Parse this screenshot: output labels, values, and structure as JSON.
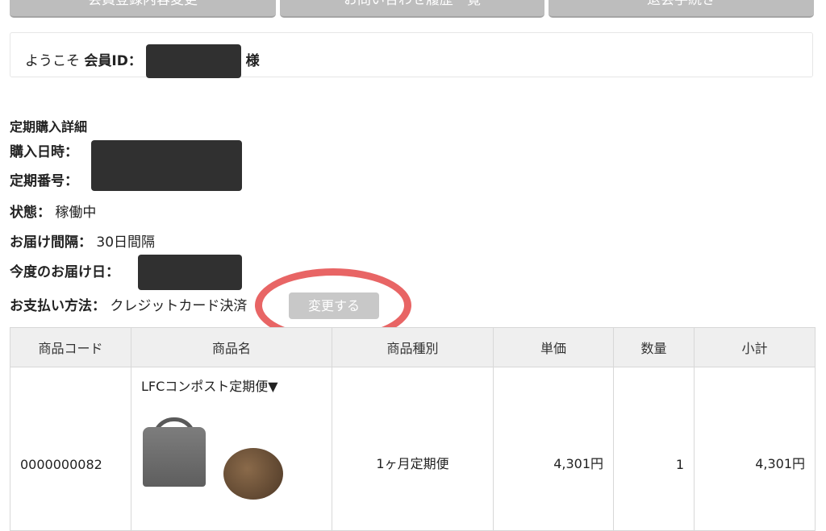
{
  "nav": {
    "buttons": [
      "会員登録内容変更",
      "お問い合わせ履歴一覧",
      "退会手続き"
    ]
  },
  "welcome": {
    "prefix": "ようこそ",
    "id_label": "会員ID：",
    "suffix": "様"
  },
  "detail": {
    "title": "定期購入詳細",
    "purchase_date_label": "購入日時：",
    "order_no_label": "定期番号：",
    "status_label": "状態：",
    "status_value": "稼働中",
    "interval_label": "お届け間隔：",
    "interval_value": "30日間隔",
    "next_delivery_label": "今度のお届け日：",
    "payment_label": "お支払い方法：",
    "payment_value": "クレジットカード決済",
    "change_button": "変更する"
  },
  "table": {
    "headers": [
      "商品コード",
      "商品名",
      "商品種別",
      "単価",
      "数量",
      "小計"
    ],
    "rows": [
      {
        "code": "0000000082",
        "name": "LFCコンポスト定期便▼",
        "type": "1ヶ月定期便",
        "unit_price": "4,301円",
        "quantity": "1",
        "subtotal": "4,301円"
      }
    ]
  },
  "colors": {
    "nav_button": "#bdbdbd",
    "highlight_circle": "#e86565",
    "change_button": "#c8c8c8",
    "redaction": "#303030"
  }
}
